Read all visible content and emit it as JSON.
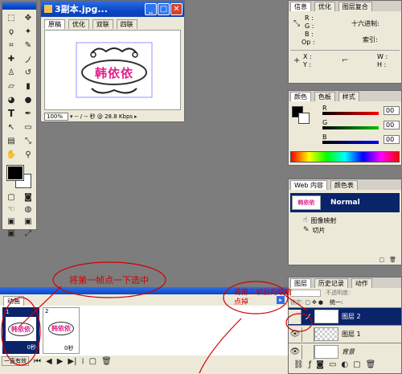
{
  "doc": {
    "title": "3副本.jpg...",
    "tabs": [
      "原稿",
      "优化",
      "双联",
      "四联"
    ],
    "active_tab": 0,
    "zoom": "100%",
    "status": "-- / -- 秒 @ 28.8 Kbps",
    "artwork_text": "韩依依"
  },
  "info": {
    "tabs": [
      "信息",
      "优化",
      "图层复合"
    ],
    "rgb": [
      "R :",
      "G :",
      "B :",
      "Op :"
    ],
    "hex_label": "十六进制:",
    "index_label": "索引:",
    "x": "X :",
    "y": "Y :",
    "w": "W :",
    "h": "H :"
  },
  "color": {
    "tabs": [
      "颜色",
      "色板",
      "样式"
    ],
    "channels": [
      {
        "label": "R",
        "value": "00",
        "color": "#ff0000"
      },
      {
        "label": "G",
        "value": "00",
        "color": "#00c000"
      },
      {
        "label": "B",
        "value": "00",
        "color": "#0000ff"
      }
    ]
  },
  "web": {
    "tabs": [
      "Web 内容",
      "颜色表"
    ],
    "normal_label": "Normal",
    "items": [
      "图像映射",
      "切片"
    ]
  },
  "layers": {
    "tabs": [
      "图层",
      "历史记录",
      "动作"
    ],
    "opacity_label": "不透明度:",
    "unify_label": "统一:",
    "lock_label": "锁定:",
    "rows": [
      {
        "name": "图层 2",
        "selected": true,
        "visible": false
      },
      {
        "name": "图层 1",
        "selected": false,
        "visible": true
      },
      {
        "name": "背景",
        "selected": false,
        "visible": true
      }
    ]
  },
  "animation": {
    "tab": "动画",
    "frames": [
      {
        "num": "1",
        "delay": "0秒"
      },
      {
        "num": "2",
        "delay": "0秒"
      }
    ],
    "loop": "一直有效"
  },
  "annotations": {
    "note1": "将第一帧点一下选中",
    "note2_line1": "将第二帧前的眼睛",
    "note2_line2": "点掉"
  },
  "colors": {
    "xp_blue": "#0a48c8",
    "selection": "#0a246a",
    "annotation_red": "#d00000",
    "artwork_pink": "#e0208a"
  }
}
